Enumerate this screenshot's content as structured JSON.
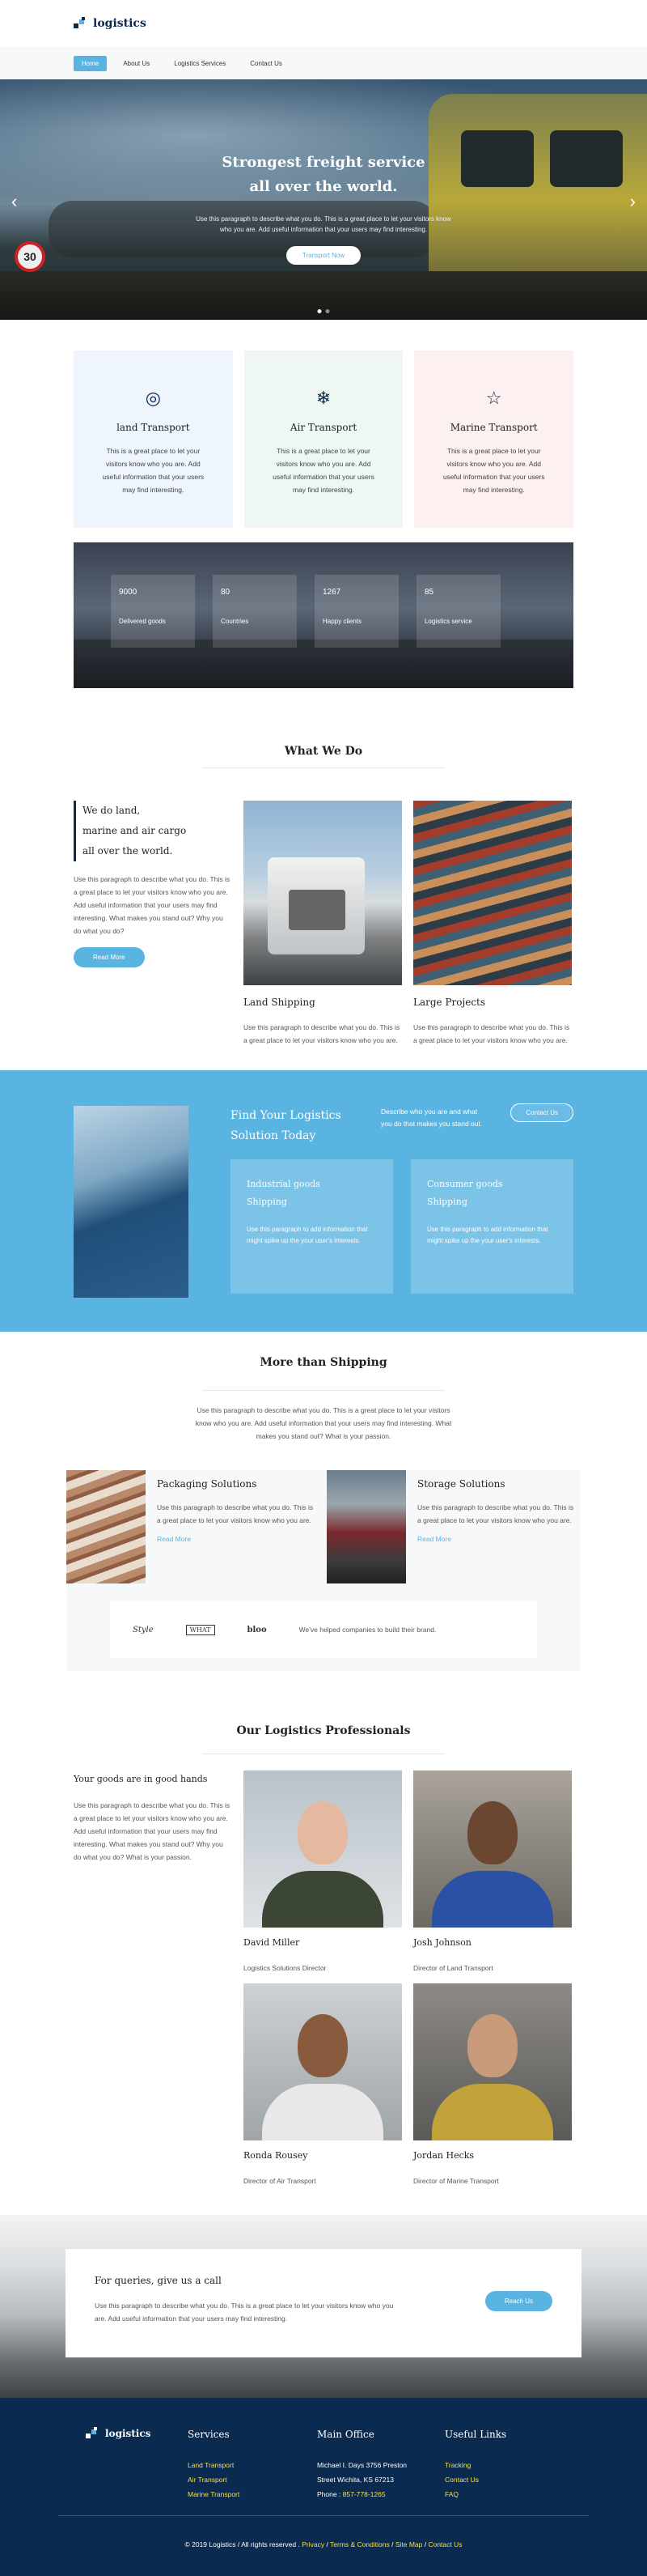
{
  "brand": {
    "name": "logistics",
    "colors": {
      "accent": "#5ab4e2",
      "navy": "#0b2a4f",
      "link_yellow": "#f5e046"
    }
  },
  "nav": [
    {
      "label": "Home",
      "active": true
    },
    {
      "label": "About Us",
      "active": false
    },
    {
      "label": "Logistics Services",
      "active": false
    },
    {
      "label": "Contact Us",
      "active": false
    }
  ],
  "hero": {
    "title_line1": "Strongest freight service",
    "title_line2": "all over the world.",
    "text_line1": "Use this paragraph to describe what you do. This is a great place to let your visitors know",
    "text_line2": "who you are. Add useful information that your users may find interesting.",
    "cta": "Transport Now",
    "sign": "30",
    "prev_icon": "chevron-left-icon",
    "next_icon": "chevron-right-icon"
  },
  "services": [
    {
      "icon": "target-icon",
      "glyph": "◎",
      "title": "land Transport",
      "bg": "#eef5fd",
      "text": "This is a great place to let your visitors know who you are. Add useful information that your users may find interesting."
    },
    {
      "icon": "snowflake-icon",
      "glyph": "❄",
      "title": "Air Transport",
      "bg": "#eef7f1",
      "text": "This is a great place to let your visitors know who you are. Add useful information that your users may find interesting."
    },
    {
      "icon": "star-icon",
      "glyph": "☆",
      "title": "Marine Transport",
      "bg": "#fdf0f1",
      "text": "This is a great place to let your visitors know who you are. Add useful information that your users may find interesting."
    }
  ],
  "stats": [
    {
      "value": "9000",
      "label": "Delivered goods"
    },
    {
      "value": "80",
      "label": "Countries"
    },
    {
      "value": "1267",
      "label": "Happy clients"
    },
    {
      "value": "85",
      "label": "Logistics service"
    }
  ],
  "what_we_do": {
    "title": "What We Do",
    "quote_l1": "We do land,",
    "quote_l2": "marine and air cargo",
    "quote_l3": "all over the world.",
    "text": "Use this paragraph to describe what you do. This is a great place to let your visitors know who you are. Add useful information that your users may find interesting. What makes you stand out? Why you do what you do?",
    "button": "Read More",
    "cards": [
      {
        "title": "Land Shipping",
        "text": "Use this paragraph to describe what you do. This is a great place to let your visitors know who you are."
      },
      {
        "title": "Large Projects",
        "text": "Use this paragraph to describe what you do. This is a great place to let your visitors know who you are."
      }
    ]
  },
  "solution": {
    "title_l1": "Find Your Logistics",
    "title_l2": "Solution Today",
    "text": "Describe who you are and what you do that makes you stand out.",
    "button": "Contact Us",
    "cards": [
      {
        "title_l1": "Industrial goods",
        "title_l2": "Shipping",
        "text": "Use this paragraph to add information that might spike up the your user's interests."
      },
      {
        "title_l1": "Consumer goods",
        "title_l2": "Shipping",
        "text": "Use this paragraph to add information that might spike up the your user's interests."
      }
    ]
  },
  "more": {
    "title": "More than Shipping",
    "text": "Use this paragraph to describe what you do. This is a great place to let your visitors know who you are. Add useful information that your users may find interesting. What makes you stand out? What is your passion.",
    "items": [
      {
        "title": "Packaging Solutions",
        "text": "Use this paragraph to describe what you do. This is a great place to let your visitors know who you are.",
        "link": "Read More"
      },
      {
        "title": "Storage Solutions",
        "text": "Use this paragraph to describe what you do. This is a great place to let your visitors know who you are.",
        "link": "Read More"
      }
    ],
    "brands": [
      "Style",
      "WHAT",
      "bloo"
    ],
    "brands_text": "We've helped companies to build their brand."
  },
  "team": {
    "title": "Our Logistics Professionals",
    "heading": "Your goods are in good hands",
    "text": "Use this paragraph to describe what you do. This is a great place to let your visitors know who you are. Add useful information that your users may find interesting. What makes you stand out? Why you do what you do? What is your passion.",
    "members": [
      {
        "name": "David Miller",
        "role": "Logistics Solutions Director"
      },
      {
        "name": "Josh Johnson",
        "role": "Director of Land Transport"
      },
      {
        "name": "Ronda Rousey",
        "role": "Director of Air Transport"
      },
      {
        "name": "Jordan Hecks",
        "role": "Director of Marine Transport"
      }
    ]
  },
  "query": {
    "title": "For queries, give us a call",
    "text": "Use this paragraph to describe what you do. This is a great place to let your visitors know who you are. Add useful information that your users may find interesting.",
    "button": "Reach Us"
  },
  "footer": {
    "logo": "logistics",
    "services_title": "Services",
    "services": [
      "Land Transport",
      "Air Transport",
      "Marine Transport"
    ],
    "office_title": "Main Office",
    "office_l1": "Michael I. Days 3756 Preston",
    "office_l2": "Street Wichita, KS 67213",
    "phone_label": "Phone : ",
    "phone": "857-778-1265",
    "links_title": "Useful Links",
    "links": [
      "Tracking",
      "Contact Us",
      "FAQ"
    ],
    "copyright": "© 2019 Logistics / All rights reserved . ",
    "bottom_links": [
      "Privacy",
      "Terms & Conditions",
      "Site Map",
      "Contact Us"
    ],
    "sep": " / "
  }
}
